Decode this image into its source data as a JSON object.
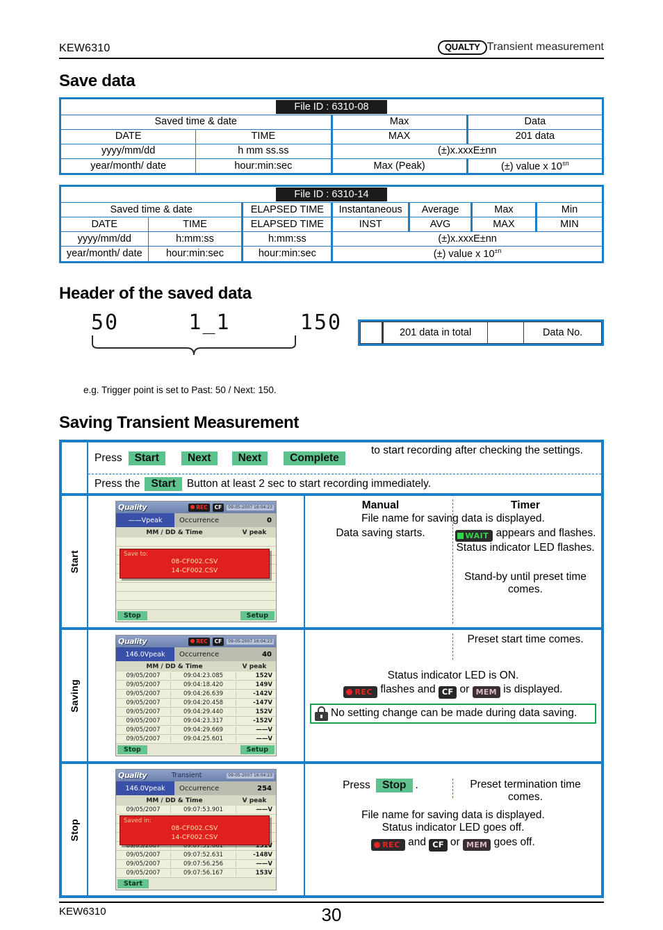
{
  "header": {
    "model": "KEW6310",
    "logo": "QUALTY",
    "section": "Transient measurement"
  },
  "titles": {
    "save_data": "Save data",
    "header_saved": "Header of the saved data",
    "saving_transient": "Saving Transient Measurement"
  },
  "table_0608": {
    "file_id": "File ID : 6310-08",
    "group_headers": [
      "Saved time & date",
      "Max",
      "Data"
    ],
    "rows": [
      [
        "DATE",
        "TIME",
        "MAX",
        "201 data"
      ],
      [
        "yyyy/mm/dd",
        "h   mm   ss.ss",
        "(±)x.xxxE±nn"
      ],
      [
        "year/month/ date",
        "hour:min:sec",
        "Max (Peak)",
        "(±) value x 10"
      ]
    ],
    "exponent": "±n"
  },
  "table_0614": {
    "file_id": "File ID : 6310-14",
    "group_headers": [
      "Saved time & date",
      "ELAPSED TIME",
      "Instantaneous",
      "Average",
      "Max",
      "Min"
    ],
    "rows": [
      [
        "DATE",
        "TIME",
        "ELAPSED TIME",
        "INST",
        "AVG",
        "MAX",
        "MIN"
      ],
      [
        "yyyy/mm/dd",
        "h:mm:ss",
        "h:mm:ss",
        "(±)x.xxxE±nn"
      ],
      [
        "year/month/ date",
        "hour:min:sec",
        "hour:min:sec",
        "(±) value x 10"
      ]
    ],
    "exponent": "±n"
  },
  "header_sample": {
    "value": "50     1_1     150",
    "legend_cells": [
      "",
      "201 data in total",
      "",
      "Data No."
    ],
    "example_note": "e.g. Trigger point is set to Past: 50 / Next: 150."
  },
  "procedure": {
    "intro_line1_prefix": "Press",
    "intro_buttons": [
      "Start",
      "Next",
      "Next",
      "Complete"
    ],
    "intro_line1_suffix": "to start recording after checking the settings.",
    "intro_line2_prefix": "Press the",
    "intro_line2_button": "Start",
    "intro_line2_suffix": "Button at least 2 sec to start recording immediately.",
    "col_headers": {
      "manual": "Manual",
      "timer": "Timer"
    },
    "rows": [
      {
        "label": "Start",
        "manual": [
          "File name for saving data is displayed.",
          "Data saving starts."
        ],
        "timer_shared": "File name for saving data is displayed.",
        "timer_badge_text": "appears and flashes.",
        "timer_lines": [
          "Status indicator LED flashes.",
          "Stand-by until preset time comes."
        ],
        "badge": "WAIT"
      },
      {
        "label": "Saving",
        "timer_line": "Preset start time comes.",
        "led_line": "Status indicator LED is ON.",
        "flash_mid": "flashes and",
        "flash_or": "or",
        "flash_end": "is displayed.",
        "warning": "No setting change can be made during data saving."
      },
      {
        "label": "Stop",
        "manual_press": "Press",
        "manual_button": "Stop",
        "manual_period": ".",
        "timer_line": "Preset termination time comes.",
        "shared_lines": [
          "File name for saving data is displayed.",
          "Status indicator LED goes off."
        ],
        "off_mid": "and",
        "off_or": "or",
        "off_end": "goes off."
      }
    ]
  },
  "badges": {
    "rec": "REC",
    "cf": "CF",
    "mem": "MEM",
    "wait": "WAIT"
  },
  "lcd_start": {
    "logo": "Quality",
    "peak": "——Vpeak",
    "occurrence": "Occurrence",
    "count": "0",
    "col_time": "MM / DD & Time",
    "col_v": "V peak",
    "dialog_label": "Save to:",
    "dialog_files": [
      "08-CF002.CSV",
      "14-CF002.CSV"
    ],
    "softkey_left": "Stop",
    "softkey_right": "Setup",
    "date_chip": "09-05-2007 16:04:23"
  },
  "lcd_saving": {
    "logo": "Quality",
    "peak": "146.0Vpeak",
    "occurrence": "Occurrence",
    "count": "40",
    "col_time": "MM / DD & Time",
    "col_v": "V peak",
    "rows": [
      [
        "09/05/2007",
        "09:04:23.085",
        "152V"
      ],
      [
        "09/05/2007",
        "09:04:18.420",
        "149V"
      ],
      [
        "09/05/2007",
        "09:04:26.639",
        "-142V"
      ],
      [
        "09/05/2007",
        "09:04:20.458",
        "-147V"
      ],
      [
        "09/05/2007",
        "09:04:29.440",
        "152V"
      ],
      [
        "09/05/2007",
        "09:04:23.317",
        "-152V"
      ],
      [
        "09/05/2007",
        "09:04:29.669",
        "——V"
      ],
      [
        "09/05/2007",
        "09:04:25.601",
        "——V"
      ]
    ],
    "softkey_left": "Stop",
    "softkey_right": "Setup",
    "date_chip": "09-05-2007 16:04:23"
  },
  "lcd_stop": {
    "logo": "Quality",
    "title": "Transient",
    "peak": "146.0Vpeak",
    "occurrence": "Occurrence",
    "count": "254",
    "col_time": "MM / DD & Time",
    "col_v": "V peak",
    "first_row": [
      "09/05/2007",
      "09:07:53.901",
      "——V"
    ],
    "dialog_label": "Saved in:",
    "dialog_files": [
      "08-CF002.CSV",
      "14-CF002.CSV"
    ],
    "rows": [
      [
        "09/05/2007",
        "09:07:51.661",
        "151V"
      ],
      [
        "09/05/2007",
        "09:07:52.631",
        "-148V"
      ],
      [
        "09/05/2007",
        "09:07:56.256",
        "——V"
      ],
      [
        "09/05/2007",
        "09:07:56.167",
        "153V"
      ]
    ],
    "softkey_left": "Start",
    "date_chip": "09-05-2007 16:04:23"
  },
  "footer": {
    "model": "KEW6310",
    "page": "30"
  }
}
